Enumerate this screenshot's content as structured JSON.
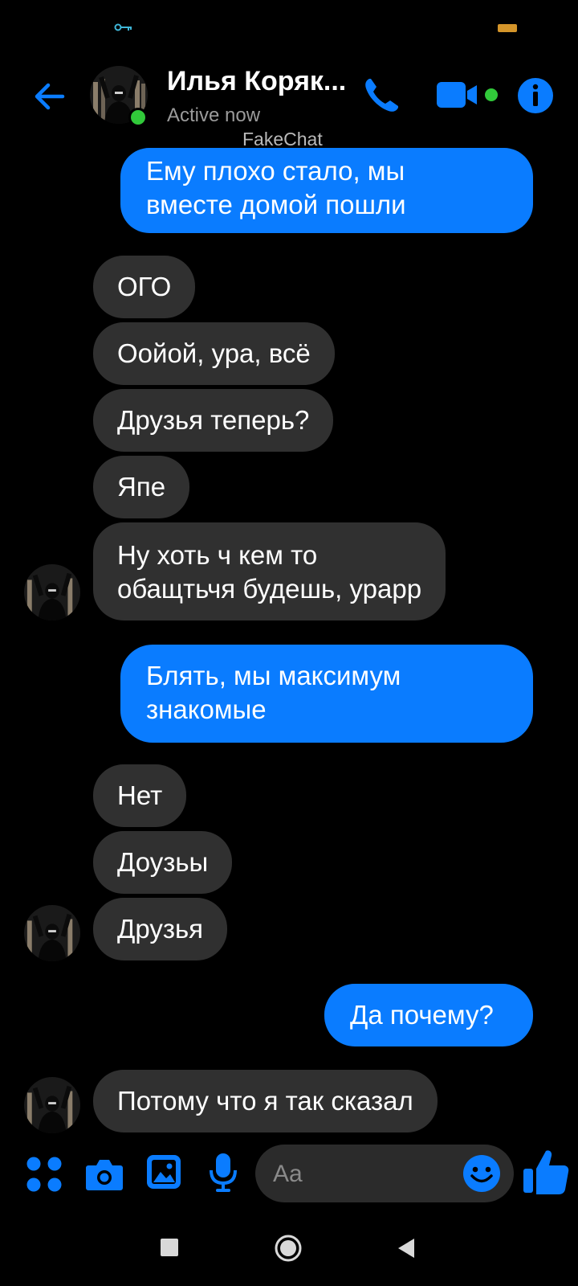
{
  "colors": {
    "accent": "#0a7cff",
    "incoming_bubble": "#303030",
    "online": "#31c93a",
    "background": "#000000"
  },
  "header": {
    "contact_name": "Илья Коряк...",
    "status": "Active now",
    "watermark": "FakeChat"
  },
  "messages": [
    {
      "direction": "outgoing",
      "text": [
        "Ему плохо стало, мы",
        "вместе домой пошли"
      ]
    },
    {
      "direction": "incoming",
      "text": [
        "ОГО"
      ]
    },
    {
      "direction": "incoming",
      "text": [
        "Оойой, ура, всё"
      ]
    },
    {
      "direction": "incoming",
      "text": [
        "Друзья теперь?"
      ]
    },
    {
      "direction": "incoming",
      "text": [
        "Япе"
      ]
    },
    {
      "direction": "incoming",
      "text": [
        "Ну хоть ч кем то",
        "обащтьчя будешь, урарр"
      ],
      "avatar": true
    },
    {
      "direction": "outgoing",
      "text": [
        "Блять, мы максимум",
        "знакомые"
      ]
    },
    {
      "direction": "incoming",
      "text": [
        "Нет"
      ]
    },
    {
      "direction": "incoming",
      "text": [
        "Доузьы"
      ]
    },
    {
      "direction": "incoming",
      "text": [
        "Друзья"
      ],
      "avatar": true
    },
    {
      "direction": "outgoing",
      "text": [
        "Да почему?"
      ]
    },
    {
      "direction": "incoming",
      "text": [
        "Потому что я так сказал"
      ],
      "avatar": true
    }
  ],
  "composer": {
    "placeholder": "Aa",
    "icons": [
      "menu-dots-icon",
      "camera-icon",
      "gallery-icon",
      "microphone-icon",
      "emoji-icon",
      "thumbs-up-icon"
    ]
  },
  "navbar": {
    "icons": [
      "recent-apps-icon",
      "home-icon",
      "back-nav-icon"
    ]
  }
}
